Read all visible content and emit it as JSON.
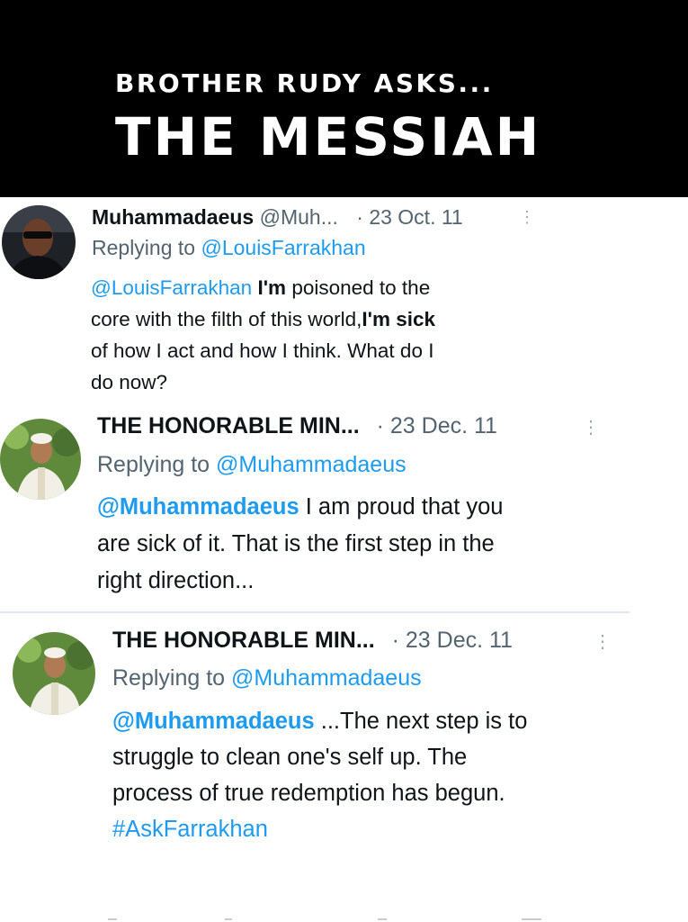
{
  "banner": {
    "subtitle": "BROTHER RUDY ASKS...",
    "title": "THE MESSIAH"
  },
  "tweets": [
    {
      "name": "Muhammadaeus",
      "handle": "@Muh...",
      "date": "· 23 Oct. 11",
      "more_icon": "more-vertical-icon",
      "reply_prefix": "Replying to",
      "reply_to": "@LouisFarrakhan",
      "body": {
        "mention": "@LouisFarrakhan",
        "l1_bold1": "I'm",
        "l1_rest": "poisoned to the",
        "l2_start": "core with the filth of this world,",
        "l2_bold": "I'm sick",
        "l3": "of how I act and how I think. What do I",
        "l4": "do now?"
      }
    },
    {
      "name": "THE HONORABLE MIN...",
      "date": "· 23 Dec. 11",
      "more_icon": "more-vertical-icon",
      "reply_prefix": "Replying to",
      "reply_to": "@Muhammadaeus",
      "body": {
        "mention": "@Muhammadaeus",
        "l1_rest": "I am proud that you",
        "l2": "are sick of it. That is the first step in the",
        "l3": "right direction..."
      }
    },
    {
      "name": "THE HONORABLE MIN...",
      "date": "· 23 Dec. 11",
      "more_icon": "more-vertical-icon",
      "reply_prefix": "Replying to",
      "reply_to": "@Muhammadaeus",
      "body": {
        "mention": "@Muhammadaeus",
        "l1_rest": "...The next step is to",
        "l2": "struggle to clean one's self up. The",
        "l3": "process of true redemption has begun.",
        "hashtag": "#AskFarrakhan"
      }
    }
  ],
  "colors": {
    "link": "#1d9bf0",
    "muted": "#536471",
    "banner": "#000000"
  }
}
